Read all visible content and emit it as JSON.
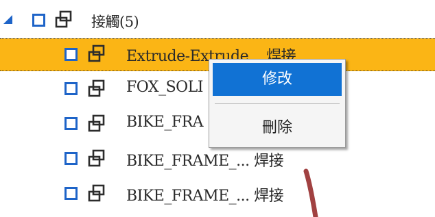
{
  "tree": {
    "parent": {
      "label": "接觸(5)",
      "icon": "assembly-icon",
      "expander": "triangle-expanded-icon"
    },
    "children": [
      {
        "label": "Extrude-Extrude... 焊接",
        "selected": true
      },
      {
        "label": "FOX_SOLI",
        "selected": false
      },
      {
        "label": "BIKE_FRA",
        "selected": false
      },
      {
        "label": "BIKE_FRAME_... 焊接",
        "selected": false
      },
      {
        "label": "BIKE_FRAME_... 焊接",
        "selected": false
      }
    ]
  },
  "context_menu": {
    "items": [
      {
        "label": "修改",
        "highlighted": true
      },
      {
        "label": "刪除",
        "highlighted": false
      }
    ]
  },
  "colors": {
    "selection": "#fbb515",
    "checkbox": "#1e64c8",
    "menu_highlight": "#1172d4",
    "annotation_stroke": "#a14141"
  }
}
